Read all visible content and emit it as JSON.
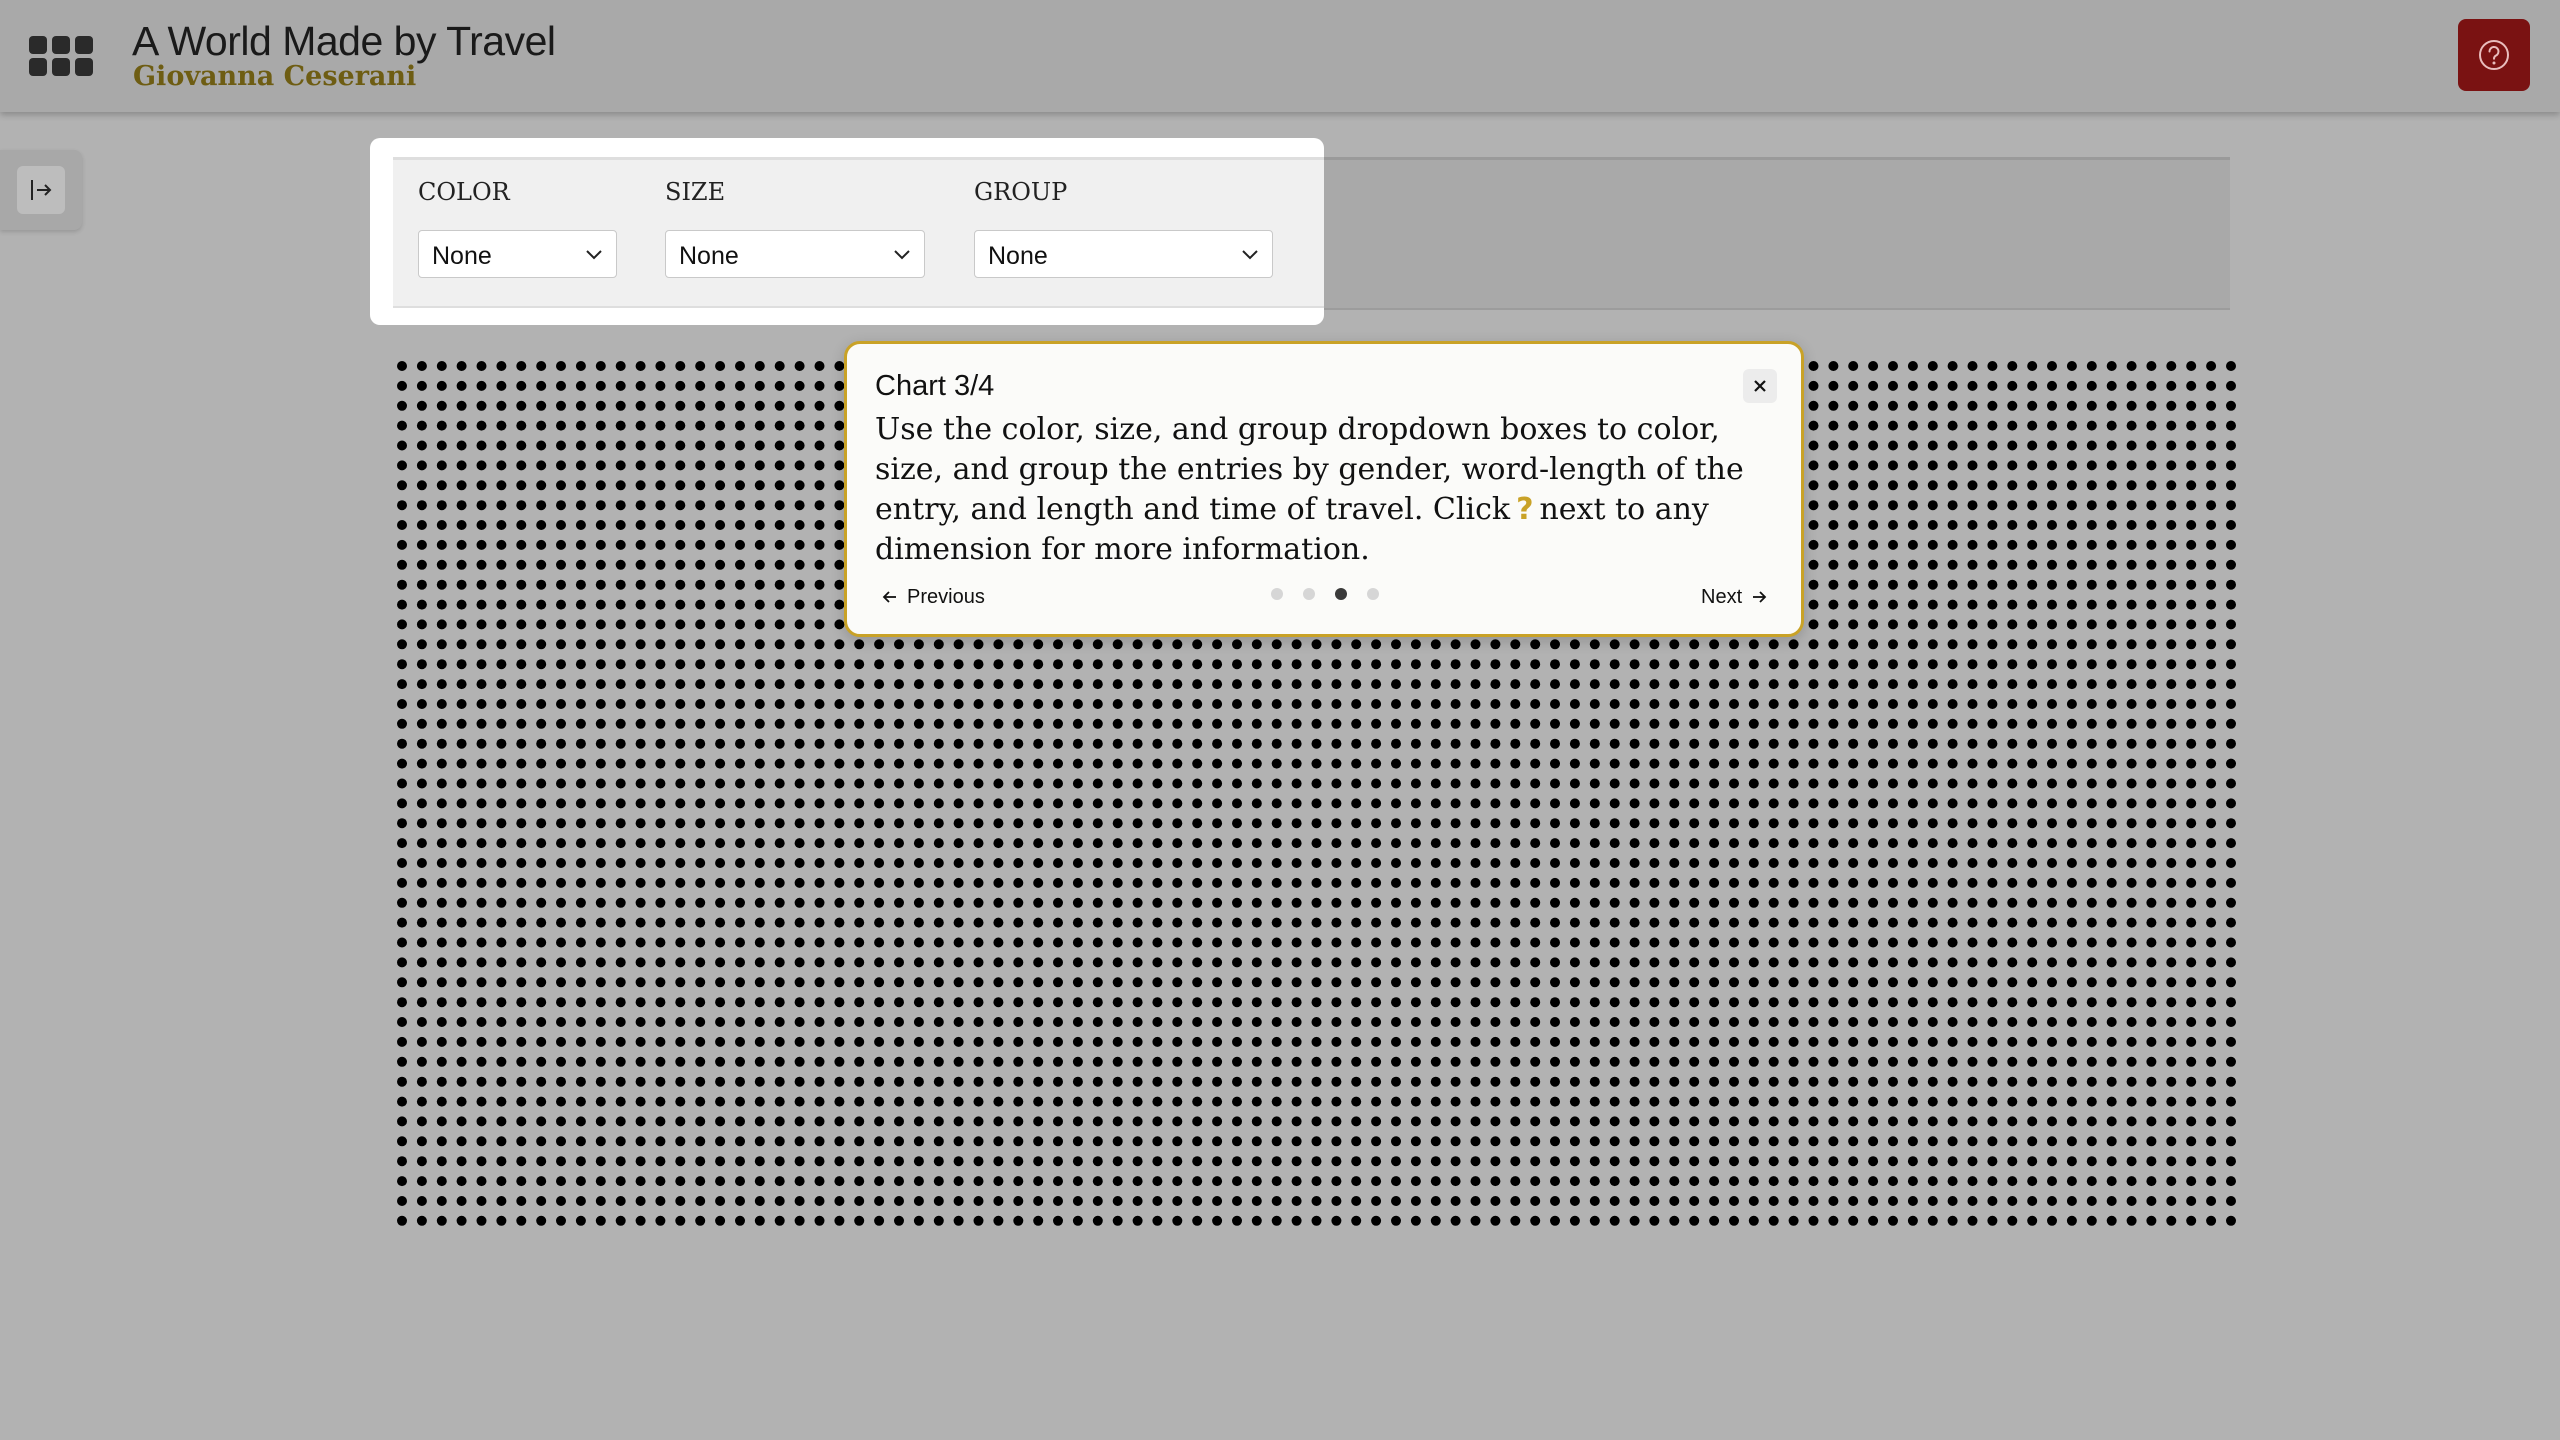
{
  "header": {
    "title": "A World Made by Travel",
    "subtitle": "Giovanna Ceserani",
    "menu_icon": "app-grid-icon",
    "help_icon": "question-circle-icon",
    "help_button_color": "#7a1212",
    "subtitle_color": "#6e5d13"
  },
  "sidebar": {
    "toggle_icon": "expand-sidebar-icon"
  },
  "controls": {
    "color_label": "COLOR",
    "color_value": "None",
    "size_label": "SIZE",
    "size_value": "None",
    "group_label": "GROUP",
    "group_value": "None"
  },
  "tour": {
    "heading": "Chart 3/4",
    "body_part1": "Use the color, size, and group dropdown boxes to color, size, and group the entries by gender, word-length of the entry, and length and time of travel. Click",
    "help_glyph": "?",
    "body_part2": "next to any dimension  for more information.",
    "previous_label": "Previous",
    "next_label": "Next",
    "step_total": 4,
    "step_current": 3,
    "accent_color": "#c9a227"
  },
  "visualization": {
    "mark": "dot",
    "dot_color": "#000000"
  }
}
